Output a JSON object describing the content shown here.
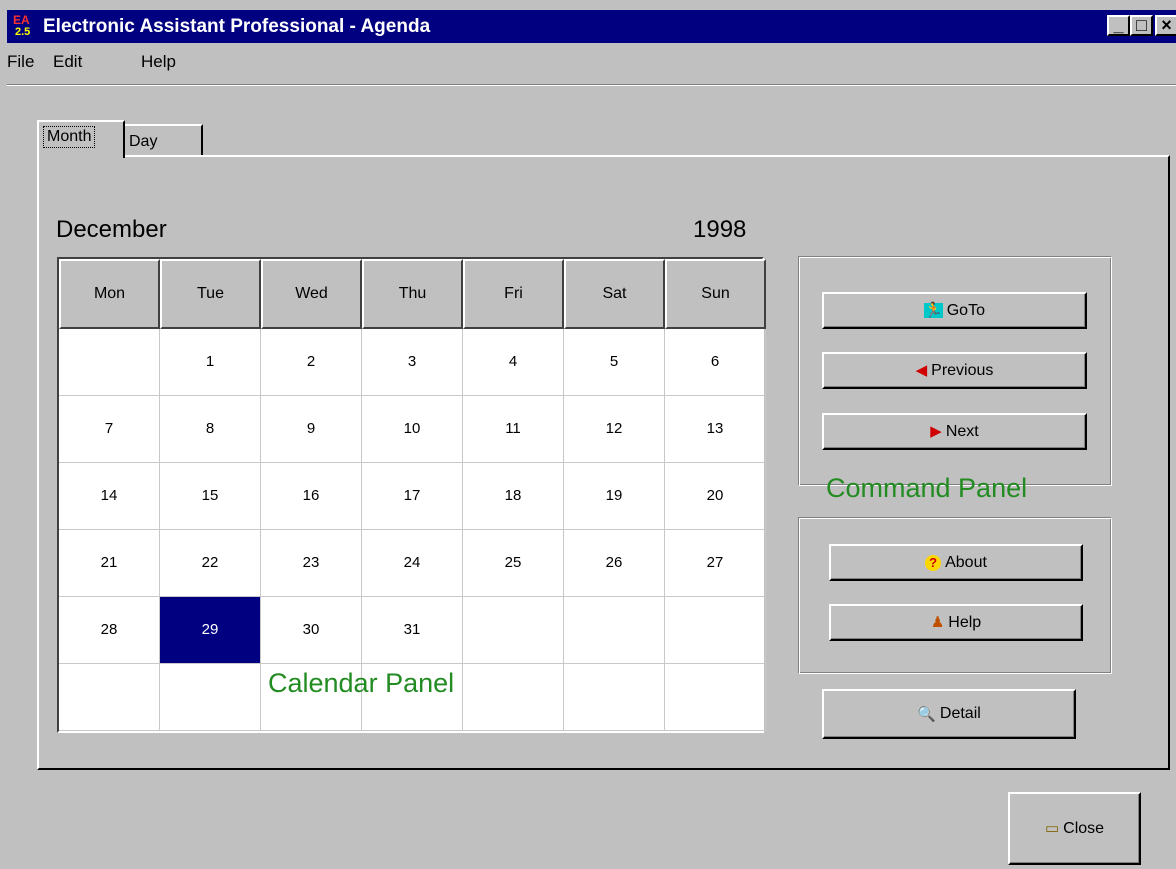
{
  "window": {
    "title": "Electronic Assistant Professional - Agenda",
    "icon_text_top": "EA",
    "icon_text_bottom": "2.5",
    "min_glyph": "_",
    "max_glyph": "□",
    "close_glyph": "×"
  },
  "menu": {
    "file": "File",
    "edit": "Edit",
    "help": "Help"
  },
  "tabs": {
    "month": "Month",
    "day": "Day"
  },
  "calendar": {
    "month": "December",
    "year": "1998",
    "days": [
      "Mon",
      "Tue",
      "Wed",
      "Thu",
      "Fri",
      "Sat",
      "Sun"
    ],
    "weeks": [
      [
        "",
        "1",
        "2",
        "3",
        "4",
        "5",
        "6"
      ],
      [
        "7",
        "8",
        "9",
        "10",
        "11",
        "12",
        "13"
      ],
      [
        "14",
        "15",
        "16",
        "17",
        "18",
        "19",
        "20"
      ],
      [
        "21",
        "22",
        "23",
        "24",
        "25",
        "26",
        "27"
      ],
      [
        "28",
        "29",
        "30",
        "31",
        "",
        "",
        ""
      ],
      [
        "",
        "",
        "",
        "",
        "",
        "",
        ""
      ]
    ],
    "selected_day": "29"
  },
  "annotations": {
    "calendar_panel": "Calendar Panel",
    "command_panel": "Command Panel"
  },
  "buttons": {
    "goto": "GoTo",
    "previous": "Previous",
    "next": "Next",
    "about": "About",
    "help": "Help",
    "detail": "Detail",
    "close": "Close"
  },
  "icons": {
    "goto": "running-man-icon",
    "previous": "arrow-left-icon",
    "next": "arrow-right-icon",
    "about": "question-icon",
    "help": "help-people-icon",
    "detail": "magnifier-icon",
    "close": "folder-icon"
  },
  "colors": {
    "title_bar": "#000080",
    "selected_day_bg": "#000080",
    "annotation_text": "#228b22",
    "window_bg": "#c0c0c0"
  }
}
